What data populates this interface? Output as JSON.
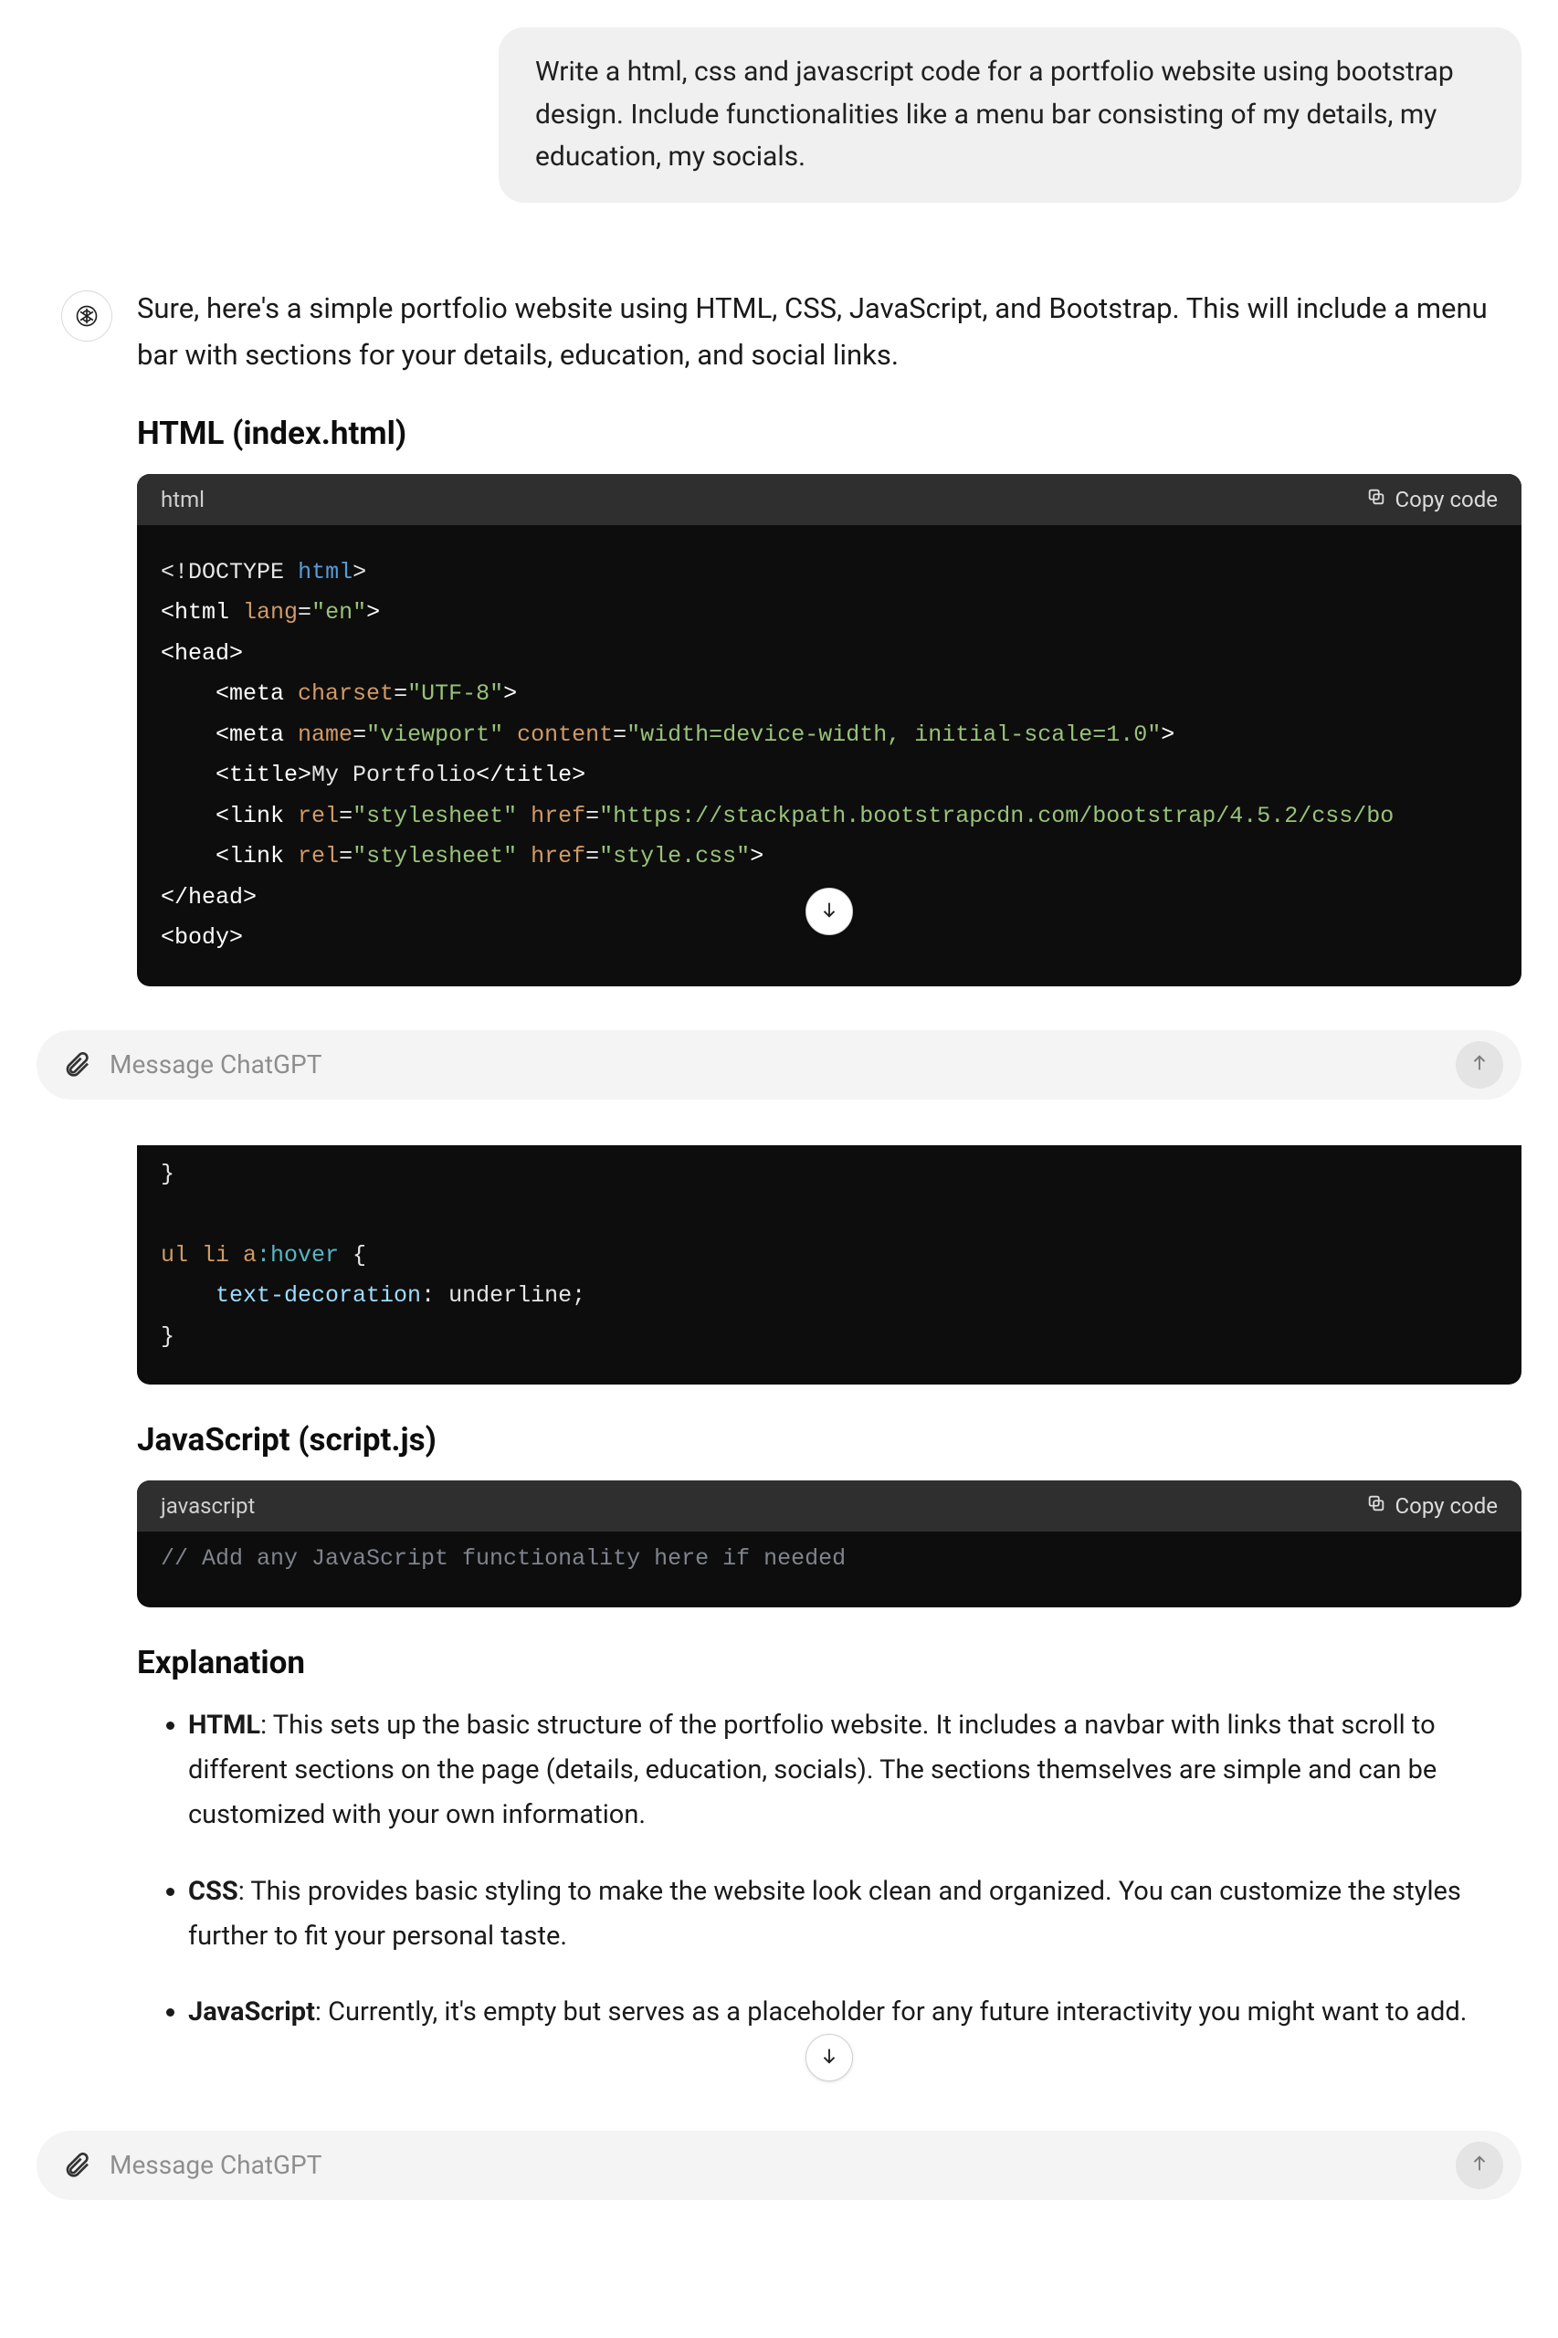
{
  "user_message": "Write a html, css and javascript code for a portfolio website using bootstrap design. Include functionalities like a menu bar consisting of my details, my education, my socials.",
  "assistant_intro": "Sure, here's a simple portfolio website using HTML, CSS, JavaScript, and Bootstrap. This will include a menu bar with sections for your details, education, and social links.",
  "section_html_title": "HTML (index.html)",
  "section_js_title": "JavaScript (script.js)",
  "section_explanation_title": "Explanation",
  "code_header_html": "html",
  "code_header_js": "javascript",
  "copy_label": "Copy code",
  "input_placeholder": "Message ChatGPT",
  "html_code": {
    "doctype_open": "<!",
    "doctype_kw": "DOCTYPE",
    "doctype_html": "html",
    "doctype_close": ">",
    "html_open": "<html",
    "lang_attr": "lang",
    "lang_val": "\"en\"",
    "gt": ">",
    "head_open": "<head>",
    "meta_open": "<meta",
    "charset_attr": "charset",
    "charset_val": "\"UTF-8\"",
    "name_attr": "name",
    "viewport_val": "\"viewport\"",
    "content_attr": "content",
    "content_val": "\"width=device-width, initial-scale=1.0\"",
    "title_open": "<title>",
    "title_text": "My Portfolio",
    "title_close": "</title>",
    "link_open": "<link",
    "rel_attr": "rel",
    "stylesheet_val": "\"stylesheet\"",
    "href_attr": "href",
    "bootstrap_href": "\"https://stackpath.bootstrapcdn.com/bootstrap/4.5.2/css/bo",
    "style_href": "\"style.css\"",
    "head_close": "</head>",
    "body_open": "<body>"
  },
  "css_code": {
    "brace_close_top": "}",
    "selector": "ul li a",
    "pseudo": ":hover",
    "brace_open": " {",
    "prop": "text-decoration",
    "colon": ": ",
    "val": "underline",
    "semi": ";",
    "brace_close": "}"
  },
  "js_code": {
    "comment": "// Add any JavaScript functionality here if needed"
  },
  "explanation": {
    "html_label": "HTML",
    "html_text": ": This sets up the basic structure of the portfolio website. It includes a navbar with links that scroll to different sections on the page (details, education, socials). The sections themselves are simple and can be customized with your own information.",
    "css_label": "CSS",
    "css_text": ": This provides basic styling to make the website look clean and organized. You can customize the styles further to fit your personal taste.",
    "js_label": "JavaScript",
    "js_text": ": Currently, it's empty but serves as a placeholder for any future interactivity you might want to add."
  }
}
